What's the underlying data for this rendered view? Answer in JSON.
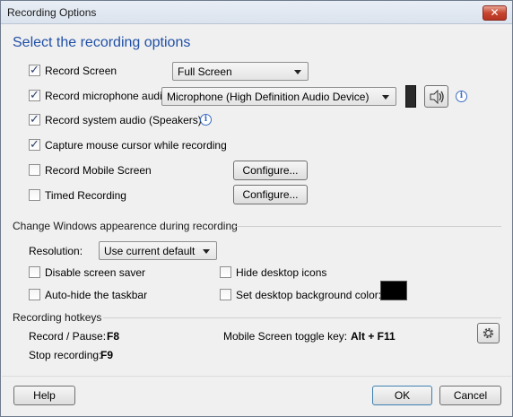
{
  "window": {
    "title": "Recording Options",
    "close_label": "✕"
  },
  "heading": "Select the recording options",
  "options": {
    "record_screen": {
      "label": "Record Screen",
      "checked": true,
      "mode": "Full Screen"
    },
    "record_microphone": {
      "label": "Record microphone audio",
      "checked": true,
      "device": "Microphone (High Definition Audio Device)"
    },
    "record_system_audio": {
      "label": "Record system audio (Speakers)",
      "checked": true
    },
    "capture_cursor": {
      "label": "Capture mouse cursor while recording",
      "checked": true
    },
    "record_mobile": {
      "label": "Record Mobile Screen",
      "checked": false,
      "configure_label": "Configure..."
    },
    "timed_recording": {
      "label": "Timed Recording",
      "checked": false,
      "configure_label": "Configure..."
    }
  },
  "appearance": {
    "section_title": "Change Windows appearence during recording",
    "resolution_label": "Resolution:",
    "resolution_value": "Use current default",
    "disable_screensaver": {
      "label": "Disable screen saver",
      "checked": false
    },
    "hide_desktop_icons": {
      "label": "Hide desktop icons",
      "checked": false
    },
    "autohide_taskbar": {
      "label": "Auto-hide the taskbar",
      "checked": false
    },
    "set_bg_color": {
      "label": "Set desktop background color:",
      "checked": false
    },
    "bg_color": "#000000"
  },
  "hotkeys": {
    "section_title": "Recording hotkeys",
    "record_pause_label": "Record / Pause:",
    "record_pause_key": "F8",
    "mobile_toggle_label": "Mobile Screen toggle key:",
    "mobile_toggle_key": "Alt + F11",
    "stop_label": "Stop recording:",
    "stop_key": "F9"
  },
  "footer": {
    "help_label": "Help",
    "ok_label": "OK",
    "cancel_label": "Cancel"
  },
  "colors": {
    "heading": "#1f4fa6",
    "accent": "#3c6cc4",
    "close": "#c7442f"
  },
  "icons": {
    "info": "info-icon",
    "speaker": "speaker-icon",
    "settings": "gear-icon",
    "level_meter": "audio-level-meter"
  }
}
